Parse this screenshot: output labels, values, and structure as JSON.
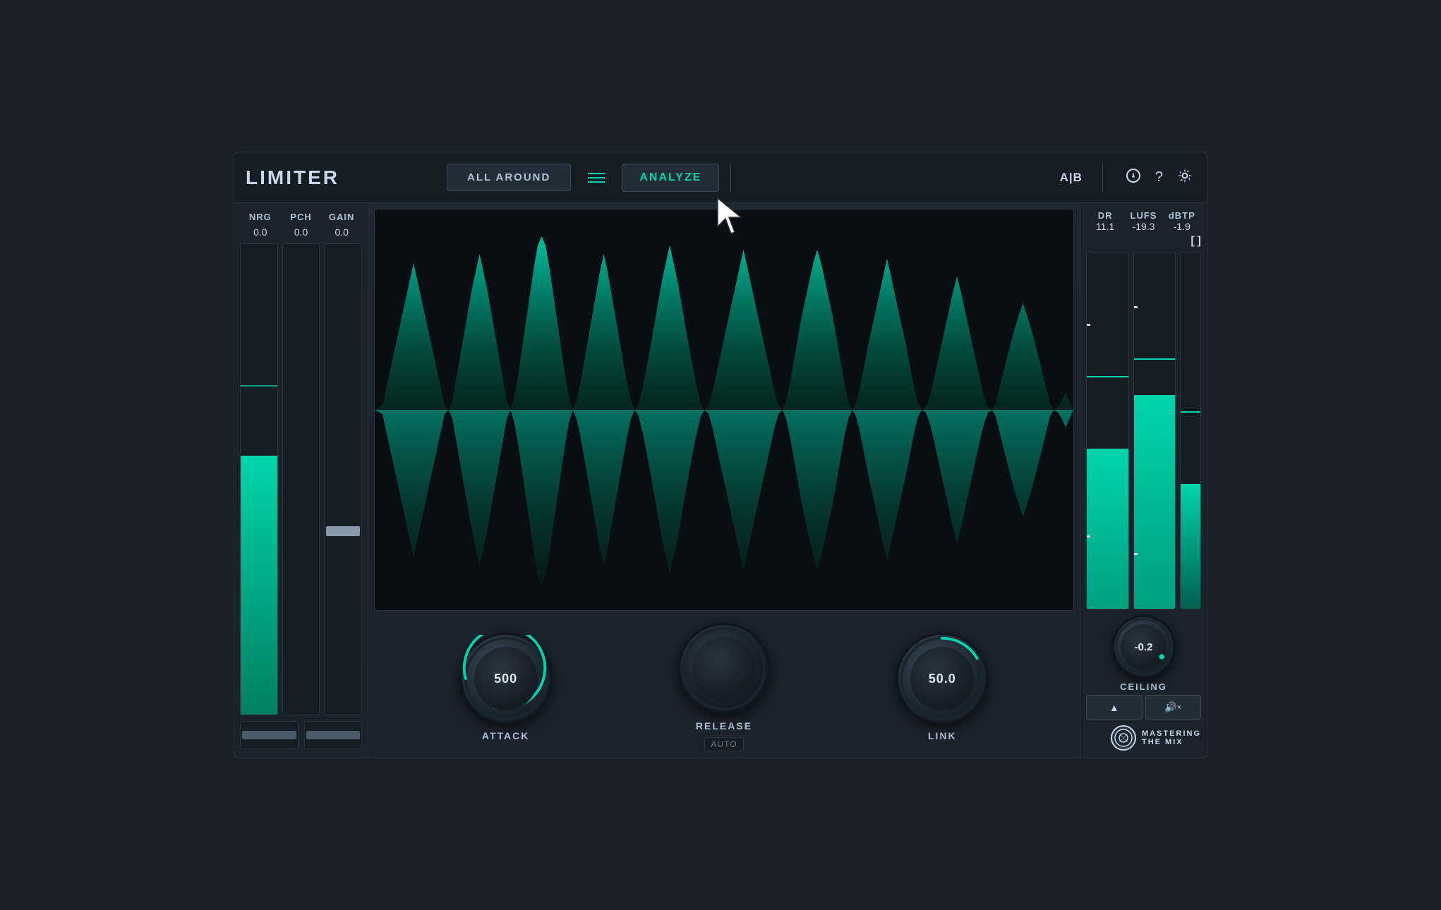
{
  "app": {
    "title": "LIMITER"
  },
  "topbar": {
    "preset_label": "ALL AROUND",
    "hamburger_label": "☰",
    "analyze_label": "ANALYZE",
    "ab_label": "A|B",
    "icons": {
      "paint": "✎",
      "help": "?",
      "settings": "⚙"
    }
  },
  "left_panel": {
    "meter_labels": [
      "NRG",
      "PCH",
      "GAIN"
    ],
    "meter_values": [
      "0.0",
      "0.0",
      "0.0"
    ],
    "nrg_fill_pct": 55,
    "pch_fill_pct": 0
  },
  "controls": {
    "attack": {
      "value": "500",
      "label": "ATTACK",
      "arc_pct": 0.8
    },
    "release": {
      "value": "",
      "label": "RELEASE",
      "sublabel": "AUTO",
      "arc_pct": 0
    },
    "link": {
      "value": "50.0",
      "label": "LINK",
      "arc_pct": 0.55
    }
  },
  "right_panel": {
    "metrics": {
      "dr_label": "DR",
      "lufs_label": "LUFS",
      "dbtp_label": "dBTP",
      "dr_value": "11.1",
      "lufs_value": "-19.3",
      "dbtp_value": "-1.9"
    },
    "brackets": "[ ]",
    "meter1_fill_pct": 45,
    "meter2_fill_pct": 60,
    "meter3_fill_pct": 40
  },
  "ceiling": {
    "value": "-0.2",
    "label": "CEILING",
    "arrow_label": "▲",
    "mute_label": "🔊×"
  },
  "branding": {
    "line1": "MASTERING",
    "line2": "THE MIX"
  }
}
